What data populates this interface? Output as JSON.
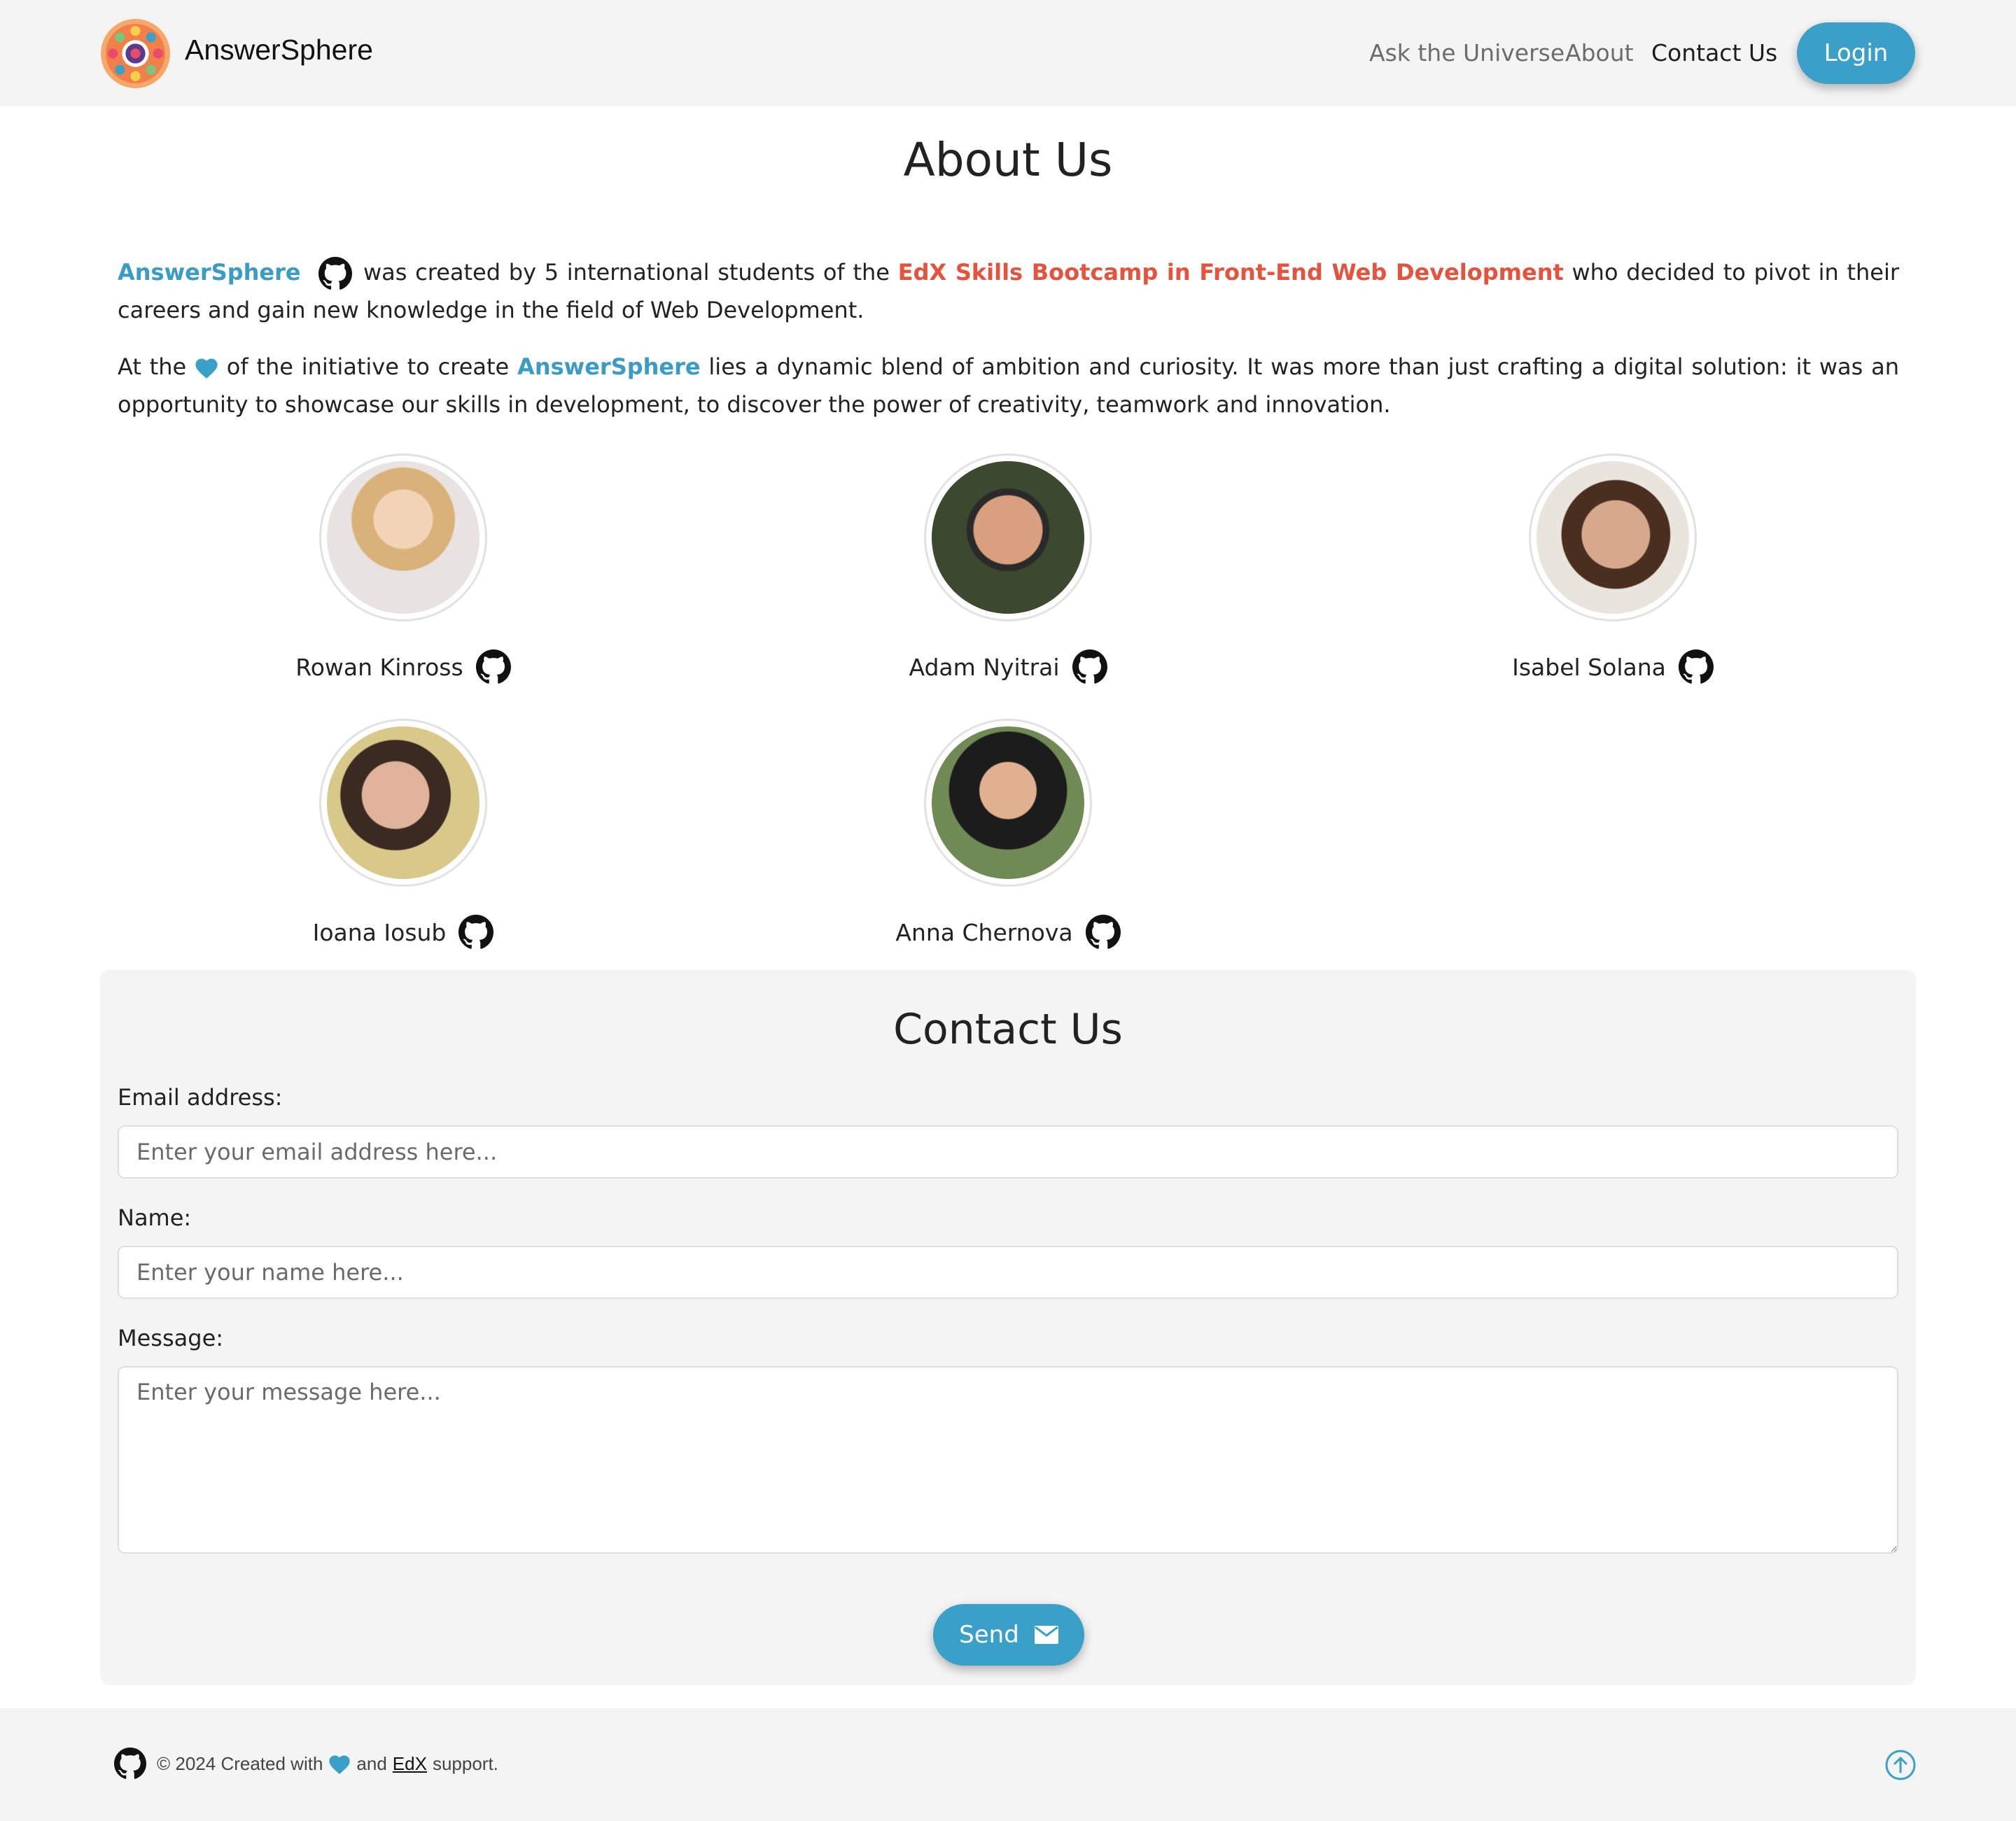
{
  "header": {
    "brand": "AnswerSphere",
    "nav": [
      "Ask the Universe",
      "About",
      "Contact Us"
    ],
    "login_label": "Login"
  },
  "about": {
    "title": "About Us",
    "p1": {
      "brand": "AnswerSphere",
      "text_a": " was created by 5 international students of the ",
      "bootcamp": "EdX Skills Bootcamp in Front-End Web Development",
      "text_b": " who decided to pivot in their careers and gain new knowledge in the field of Web Development."
    },
    "p2": {
      "text_a": "At the ",
      "text_b": " of the initiative to create ",
      "brand": "AnswerSphere",
      "text_c": " lies a dynamic blend of ambition and curiosity. It was more than just crafting a digital solution: it was an opportunity to showcase our skills in development, to discover the power of creativity, teamwork and innovation."
    }
  },
  "team": [
    {
      "name": "Rowan Kinross",
      "icon": "github-icon"
    },
    {
      "name": "Adam Nyitrai",
      "icon": "github-icon"
    },
    {
      "name": "Isabel Solana",
      "icon": "github-icon"
    },
    {
      "name": "Ioana Iosub",
      "icon": "github-icon"
    },
    {
      "name": "Anna Chernova",
      "icon": "github-icon"
    }
  ],
  "contact": {
    "title": "Contact Us",
    "email_label": "Email address:",
    "email_placeholder": "Enter your email address here...",
    "name_label": "Name:",
    "name_placeholder": "Enter your name here...",
    "message_label": "Message:",
    "message_placeholder": "Enter your message here...",
    "send_label": "Send"
  },
  "footer": {
    "text_a": "© 2024 Created with",
    "text_b": "and",
    "edx": "EdX",
    "text_c": "support."
  },
  "colors": {
    "accent": "#3aa0c8",
    "edx_red": "#e5533d",
    "panel_bg": "#f4f4f4"
  }
}
